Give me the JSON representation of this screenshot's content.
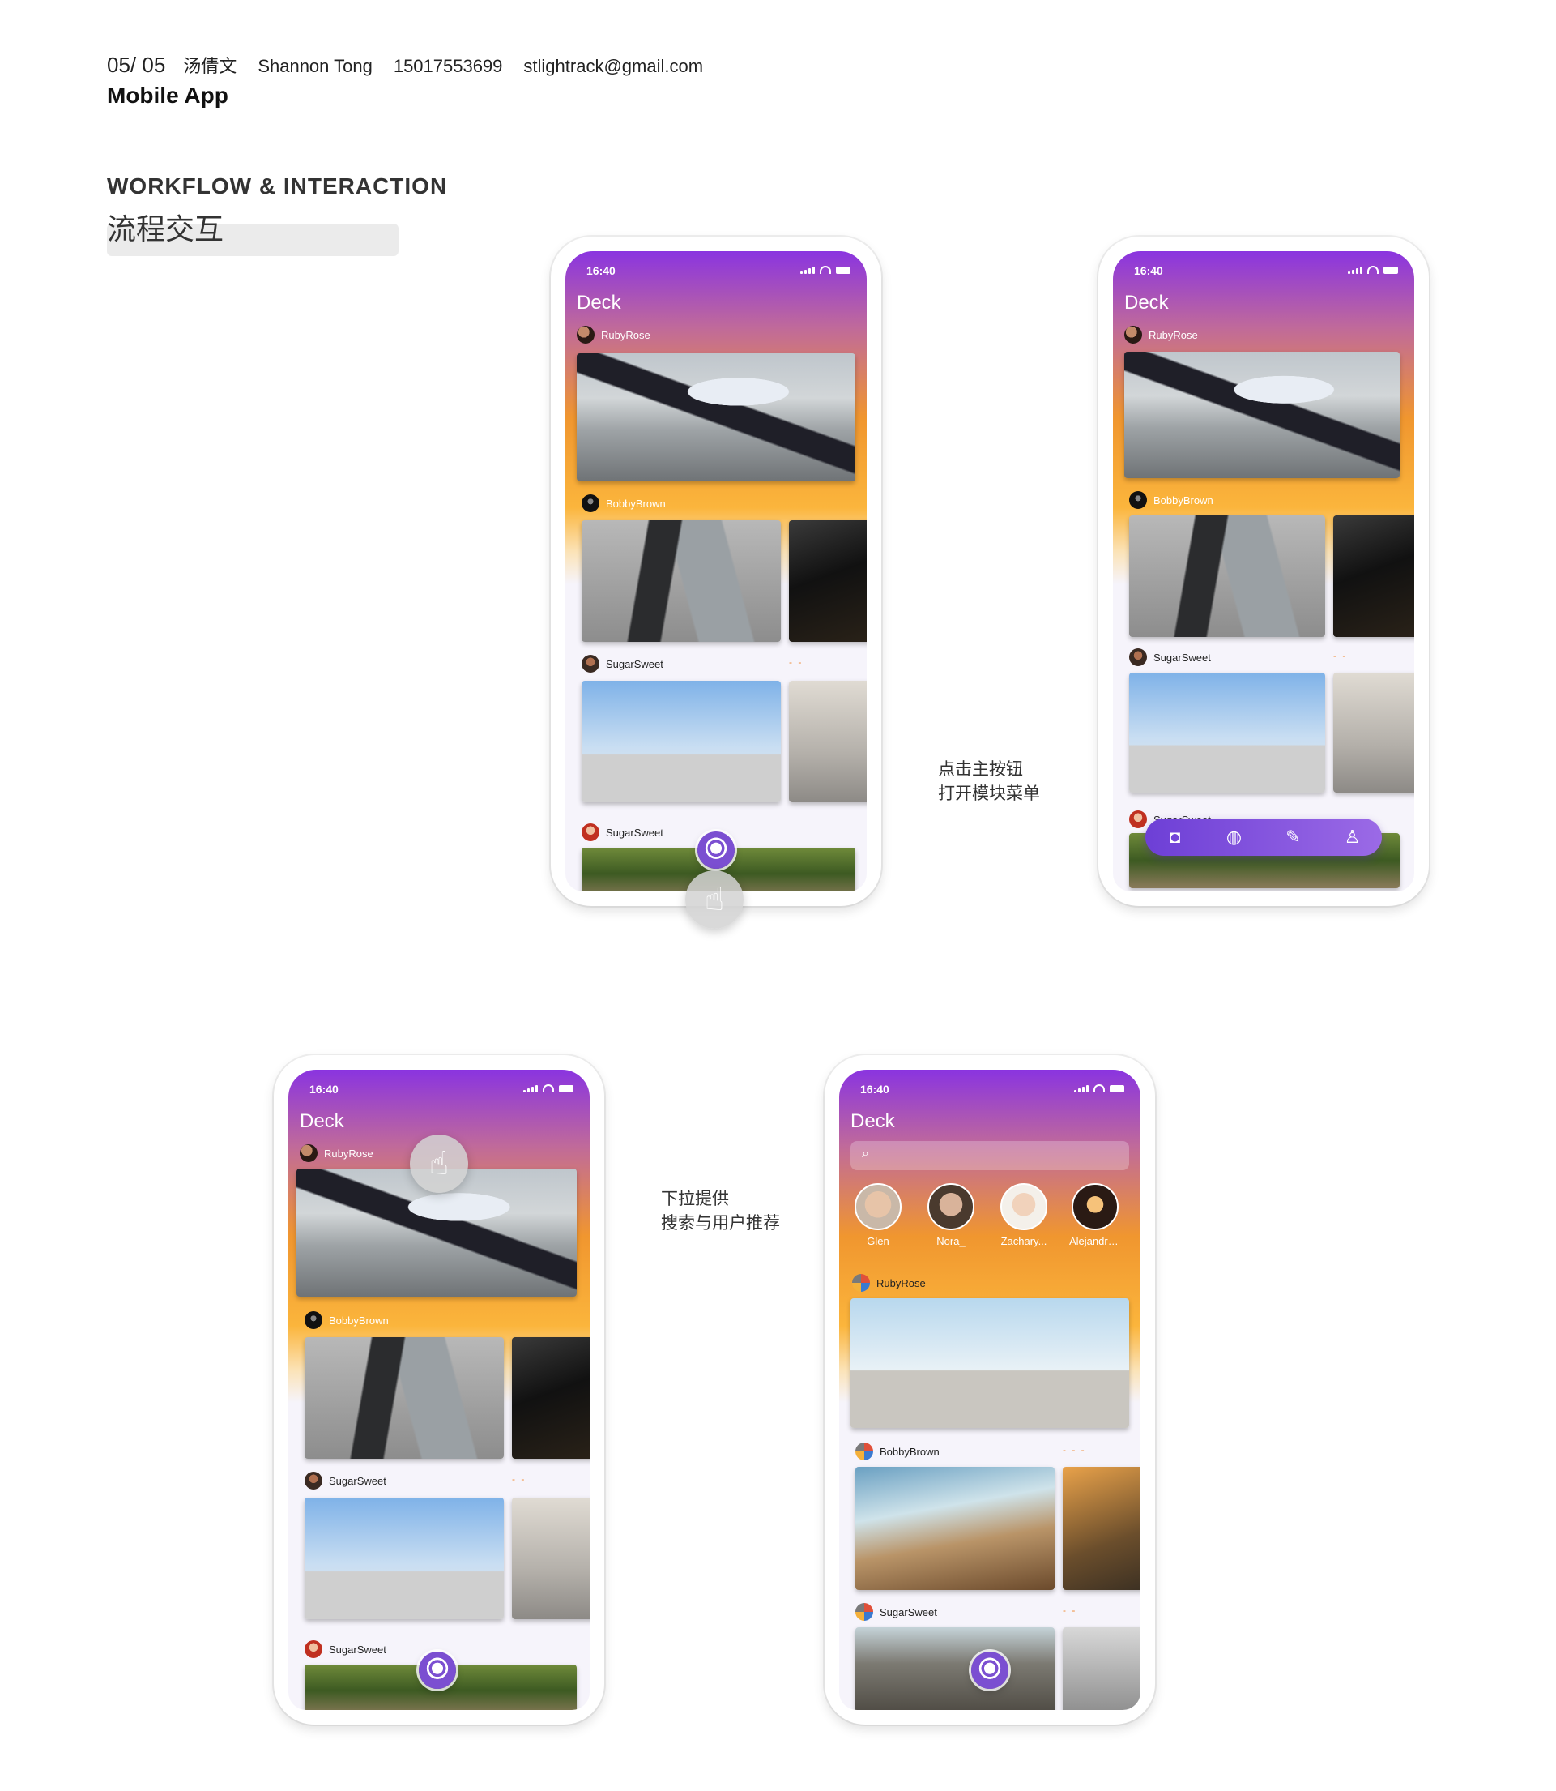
{
  "header": {
    "page": "05/ 05",
    "name_cn": "汤倩文",
    "name_en": "Shannon Tong",
    "phone": "15017553699",
    "email": "stlightrack@gmail.com",
    "subtitle": "Mobile App"
  },
  "section": {
    "title": "WORKFLOW & INTERACTION",
    "title_cn": "流程交互"
  },
  "captions": {
    "menu_line1": "点击主按钮",
    "menu_line2": "打开模块菜单",
    "search_line1": "下拉提供",
    "search_line2": "搜索与用户推荐"
  },
  "app": {
    "time": "16:40",
    "title": "Deck",
    "users": [
      "RubyRose",
      "BobbyBrown",
      "SugarSweet",
      "SugarSweet"
    ],
    "recommendations": [
      "Glen",
      "Nora_",
      "Zachary...",
      "Alejandro...."
    ],
    "menu_icons": [
      "camera-icon",
      "globe-icon",
      "feather-icon",
      "user-icon"
    ]
  },
  "colors": {
    "gradient_top": "#8a34e0",
    "gradient_mid": "#f0962f",
    "accent": "#7b4fd1"
  }
}
